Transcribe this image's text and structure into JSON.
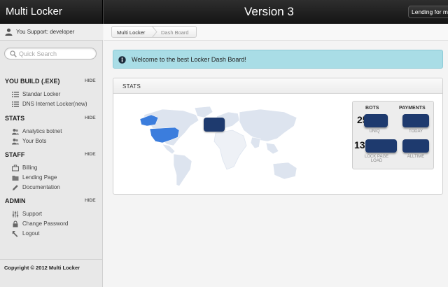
{
  "header": {
    "brand": "Multi Locker",
    "version": "Version 3",
    "right_button": "Lending for me"
  },
  "sidebar": {
    "user_text": "You Support: developer",
    "search_placeholder": "Quick Search",
    "sections": [
      {
        "title": "YOU BUILD (.EXE)",
        "hide": "HIDE",
        "items": [
          {
            "label": "Standar Locker",
            "icon": "list-icon"
          },
          {
            "label": "DNS Internet Locker(new)",
            "icon": "list-icon"
          }
        ]
      },
      {
        "title": "STATS",
        "hide": "HIDE",
        "items": [
          {
            "label": "Analytics botnet",
            "icon": "users-icon"
          },
          {
            "label": "Your Bots",
            "icon": "users-icon"
          }
        ]
      },
      {
        "title": "STAFF",
        "hide": "HIDE",
        "items": [
          {
            "label": "Billing",
            "icon": "briefcase-icon"
          },
          {
            "label": "Lending Page",
            "icon": "folder-icon"
          },
          {
            "label": "Documentation",
            "icon": "pencil-icon"
          }
        ]
      },
      {
        "title": "ADMIN",
        "hide": "HIDE",
        "items": [
          {
            "label": "Support",
            "icon": "sliders-icon"
          },
          {
            "label": "Change Password",
            "icon": "lock-icon"
          },
          {
            "label": "Logout",
            "icon": "logout-icon"
          }
        ]
      }
    ],
    "copyright": "Copyright © 2012 Multi Locker"
  },
  "breadcrumb": {
    "items": [
      "Multi Locker",
      "Dash Board"
    ]
  },
  "alert": {
    "text": "Welcome to the best Locker Dash Board!"
  },
  "stats_panel": {
    "title": "STATS",
    "bots_header": "BOTS",
    "payments_header": "PAYMENTS",
    "bots_uniq_value": "25",
    "bots_uniq_caption": "UNIQ",
    "payments_today_caption": "TODAY",
    "bots_load_value": "13",
    "bots_load_caption": "LOCK PAGE LOAD",
    "payments_alltime_caption": "ALLTIME"
  },
  "colors": {
    "accent_dark_blue": "#1e3a6e",
    "alert_bg": "#a9dde6",
    "map_highlight": "#3b7ddd",
    "map_land": "#dde4ef"
  }
}
